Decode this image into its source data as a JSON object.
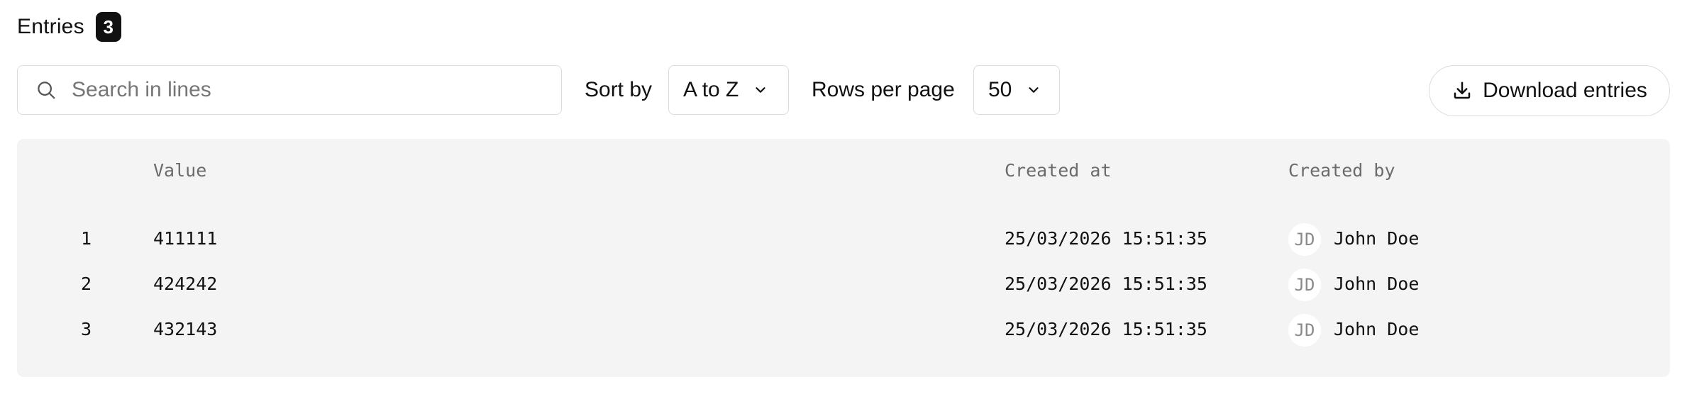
{
  "header": {
    "title": "Entries",
    "count": "3"
  },
  "toolbar": {
    "search_placeholder": "Search in lines",
    "sort_label": "Sort by",
    "sort_value": "A to Z",
    "rows_label": "Rows per page",
    "rows_value": "50",
    "download_label": "Download entries"
  },
  "table": {
    "columns": [
      "Value",
      "Created at",
      "Created by"
    ],
    "rows": [
      {
        "index": "1",
        "value": "411111",
        "created_at": "25/03/2026 15:51:35",
        "initials": "JD",
        "created_by": "John Doe"
      },
      {
        "index": "2",
        "value": "424242",
        "created_at": "25/03/2026 15:51:35",
        "initials": "JD",
        "created_by": "John Doe"
      },
      {
        "index": "3",
        "value": "432143",
        "created_at": "25/03/2026 15:51:35",
        "initials": "JD",
        "created_by": "John Doe"
      }
    ]
  },
  "icons": {
    "search": "search-icon",
    "chevron": "chevron-down-icon",
    "download": "download-icon"
  }
}
